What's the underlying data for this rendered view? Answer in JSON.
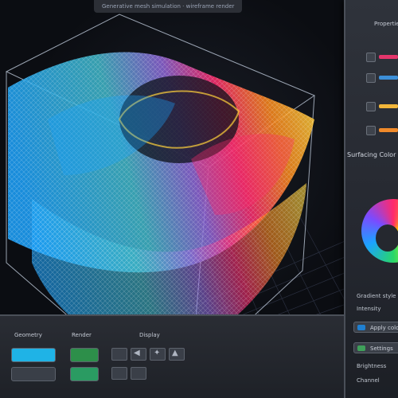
{
  "header": {
    "caption": "Generative mesh simulation · wireframe render"
  },
  "right_panel": {
    "title": "Properties",
    "section_label": "Surfacing Color",
    "items": [
      {
        "accent": "#e3356b"
      },
      {
        "accent": "#3c8fd8"
      },
      {
        "accent": "#f2b63a"
      },
      {
        "accent": "#f08a2a"
      }
    ],
    "labels": {
      "gradient": "Gradient style",
      "intensity": "Intensity",
      "brightness": "Brightness",
      "output": "Channel"
    },
    "buttons": {
      "apply": "Apply color",
      "settings": "Settings"
    }
  },
  "bottom_toolbar": {
    "label_primary": "Geometry",
    "label_secondary": "Render",
    "label_tertiary": "Display",
    "swatches": [
      "#1fb3e6",
      "#2d8f4a",
      "#3a3f48"
    ]
  },
  "colors": {
    "mesh_gradient": [
      "#1ba3ff",
      "#3db7c9",
      "#8c63d6",
      "#ff2a6d",
      "#ff8a1a",
      "#ffd23a"
    ],
    "grid": "#2b3040"
  },
  "icons": [
    "color-wheel-icon",
    "swatch-icon",
    "button-icon",
    "arrow-icon",
    "pointer-icon",
    "settings-icon"
  ]
}
